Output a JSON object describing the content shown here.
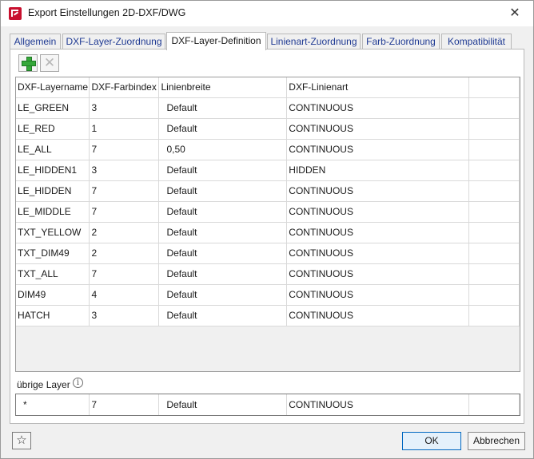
{
  "window": {
    "title": "Export Einstellungen 2D-DXF/DWG",
    "close_symbol": "✕"
  },
  "tabs": [
    {
      "label": "Allgemein"
    },
    {
      "label": "DXF-Layer-Zuordnung"
    },
    {
      "label": "DXF-Layer-Definition"
    },
    {
      "label": "Linienart-Zuordnung"
    },
    {
      "label": "Farb-Zuordnung"
    },
    {
      "label": "Kompatibilität"
    }
  ],
  "toolbar": {
    "add_icon": "plus-icon",
    "delete_icon": "x-icon"
  },
  "table": {
    "columns": [
      "DXF-Layername",
      "DXF-Farbindex",
      "Linienbreite",
      "DXF-Linienart"
    ],
    "rows": [
      [
        "LE_GREEN",
        "3",
        "Default",
        "CONTINUOUS"
      ],
      [
        "LE_RED",
        "1",
        "Default",
        "CONTINUOUS"
      ],
      [
        "LE_ALL",
        "7",
        "0,50",
        "CONTINUOUS"
      ],
      [
        "LE_HIDDEN1",
        "3",
        "Default",
        "HIDDEN"
      ],
      [
        "LE_HIDDEN",
        "7",
        "Default",
        "CONTINUOUS"
      ],
      [
        "LE_MIDDLE",
        "7",
        "Default",
        "CONTINUOUS"
      ],
      [
        "TXT_YELLOW",
        "2",
        "Default",
        "CONTINUOUS"
      ],
      [
        "TXT_DIM49",
        "2",
        "Default",
        "CONTINUOUS"
      ],
      [
        "TXT_ALL",
        "7",
        "Default",
        "CONTINUOUS"
      ],
      [
        "DIM49",
        "4",
        "Default",
        "CONTINUOUS"
      ],
      [
        "HATCH",
        "3",
        "Default",
        "CONTINUOUS"
      ]
    ]
  },
  "other_layers": {
    "label": "übrige Layer",
    "info_symbol": "i",
    "row": [
      "*",
      "7",
      "Default",
      "CONTINUOUS"
    ]
  },
  "footer": {
    "star_symbol": "☆",
    "ok_label": "OK",
    "cancel_label": "Abbrechen"
  },
  "colors": {
    "accent": "#0067c0",
    "tab_text": "#1f3a93",
    "add_green": "#35a83a"
  }
}
